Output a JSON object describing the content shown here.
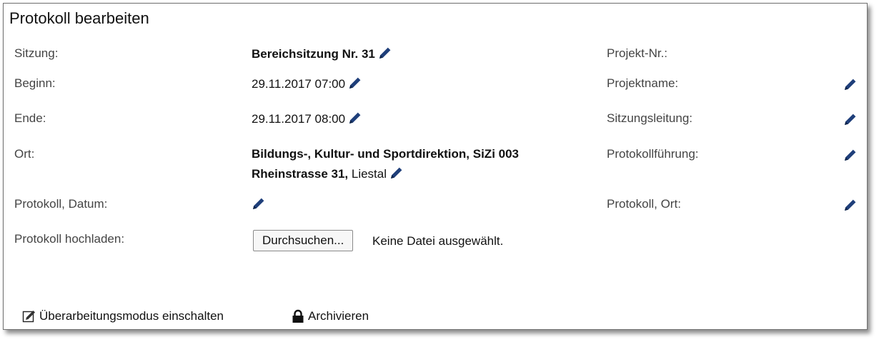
{
  "panel": {
    "title": "Protokoll bearbeiten"
  },
  "fields": {
    "sitzung": {
      "label": "Sitzung:",
      "value": "Bereichsitzung Nr. 31"
    },
    "beginn": {
      "label": "Beginn:",
      "value": "29.11.2017 07:00"
    },
    "ende": {
      "label": "Ende:",
      "value": "29.11.2017 08:00"
    },
    "ort": {
      "label": "Ort:",
      "line1": "Bildungs-, Kultur- und Sportdirektion, SiZi 003",
      "line2_bold": "Rheinstrasse 31,",
      "line2_rest": " Liestal"
    },
    "protokoll_datum": {
      "label": "Protokoll, Datum:",
      "value": ""
    },
    "protokoll_hochladen": {
      "label": "Protokoll hochladen:",
      "button": "Durchsuchen...",
      "status": "Keine Datei ausgewählt."
    },
    "projekt_nr": {
      "label": "Projekt-Nr.:",
      "value": ""
    },
    "projektname": {
      "label": "Projektname:",
      "value": ""
    },
    "sitzungsleitung": {
      "label": "Sitzungsleitung:",
      "value": ""
    },
    "protokollfuehrung": {
      "label": "Protokollführung:",
      "value": ""
    },
    "protokoll_ort": {
      "label": "Protokoll, Ort:",
      "value": ""
    }
  },
  "actions": {
    "revision_mode": {
      "label": "Überarbeitungsmodus einschalten",
      "icon": "edit-checkbox-icon"
    },
    "archive": {
      "label": "Archivieren",
      "icon": "lock-icon"
    }
  },
  "colors": {
    "pencil": "#1f3f7a",
    "border": "#6f6f6f"
  }
}
